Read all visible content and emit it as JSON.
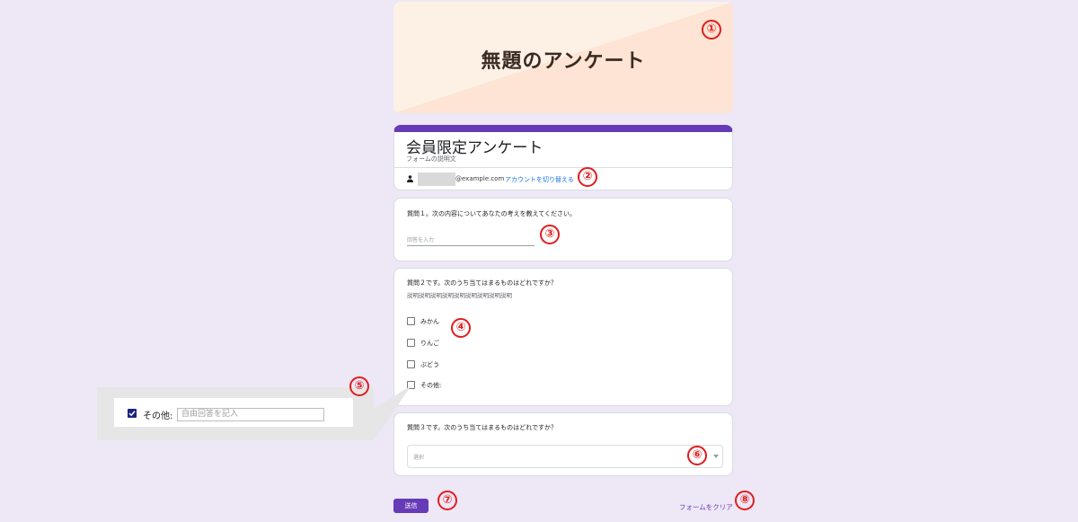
{
  "banner": {
    "title": "無題のアンケート"
  },
  "form": {
    "title": "会員限定アンケート",
    "description": "フォームの説明文",
    "account_email": "@example.com",
    "switch_account_label": "アカウントを切り替える"
  },
  "questions": [
    {
      "text": "質問１。次の内容についてあなたの考えを教えてください。",
      "placeholder": "回答を入力"
    },
    {
      "text": "質問２です。次のうち当てはまるものはどれですか？",
      "subtext": "説明説明説明説明説明説明説明説明説明",
      "options": [
        "みかん",
        "りんご",
        "ぶどう",
        "その他:"
      ]
    },
    {
      "text": "質問３です。次のうち当てはまるものはどれですか？",
      "selected": "選択"
    }
  ],
  "callout": {
    "other_label": "その他:",
    "other_placeholder": "自由回答を記入"
  },
  "footer": {
    "submit_label": "送信",
    "clear_label": "フォームをクリア"
  },
  "markers": [
    "①",
    "②",
    "③",
    "④",
    "⑤",
    "⑥",
    "⑦",
    "⑧"
  ],
  "colors": {
    "accent": "#673ab7",
    "background": "#ede7f6",
    "marker": "#e11d1d",
    "link": "#1a73e8"
  }
}
